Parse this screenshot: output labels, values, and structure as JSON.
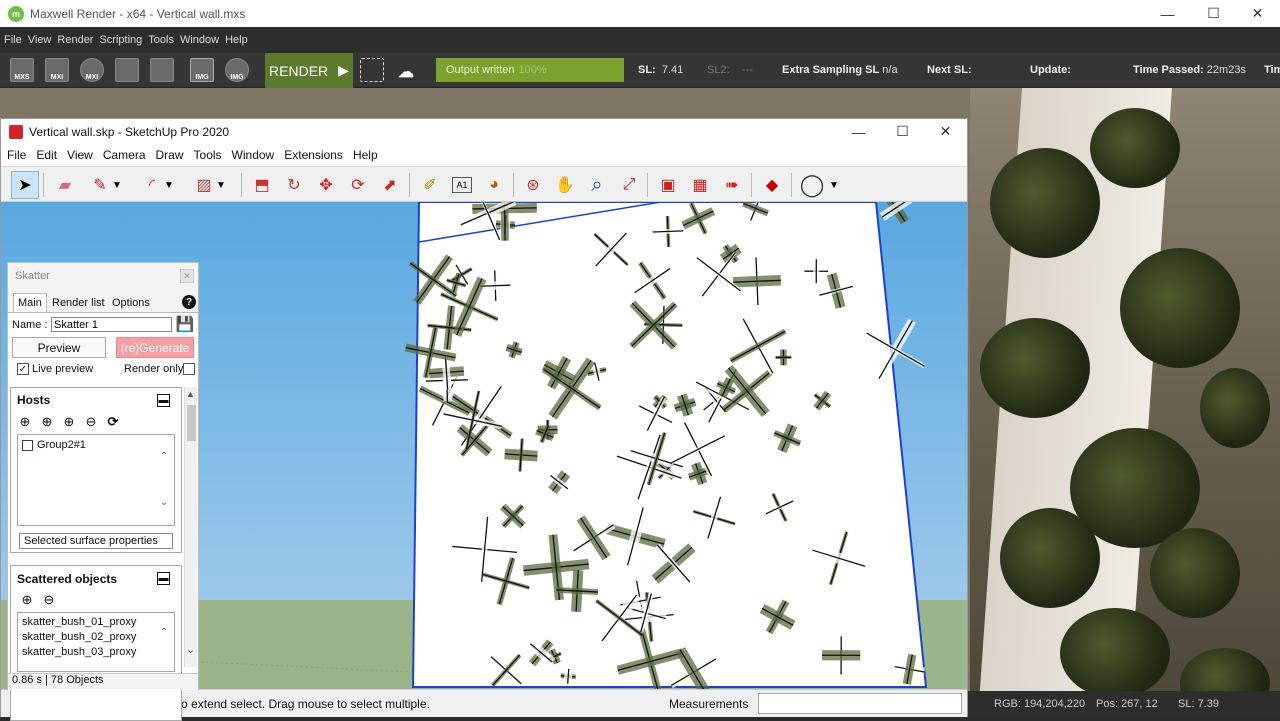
{
  "maxwell": {
    "title": "Maxwell Render  -  x64 - Vertical wall.mxs",
    "menu": [
      "File",
      "View",
      "Render",
      "Scripting",
      "Tools",
      "Window",
      "Help"
    ],
    "toolbar_icons": [
      {
        "name": "mxs-icon",
        "label": "MXS"
      },
      {
        "name": "mxi-icon",
        "label": "MXI"
      },
      {
        "name": "mxi-open-icon",
        "label": "MXI"
      },
      {
        "name": "compare-icon",
        "label": ""
      },
      {
        "name": "save-icon",
        "label": ""
      },
      {
        "name": "img-icon",
        "label": "IMG"
      },
      {
        "name": "img-save-icon",
        "label": "IMG"
      }
    ],
    "render_label": "RENDER",
    "progress_text": "Output written",
    "progress_pct": "100%",
    "progress_fraction": 1.0,
    "sl_label": "SL:",
    "sl_value": "7.41",
    "sl2_label": "SL2:",
    "sl2_value": "---",
    "extra_label": "Extra Sampling SL",
    "extra_value": "n/a",
    "next_sl_label": "Next SL:",
    "update_label": "Update:",
    "time_label": "Time Passed:",
    "time_value": "22m23s",
    "time_remaining_label": "Tim",
    "bottom": {
      "rgb": "RGB: 194,204,220",
      "pos": "Pos: 267, 12",
      "sl": "SL: 7.39"
    }
  },
  "sketchup": {
    "title": "Vertical wall.skp - SketchUp Pro 2020",
    "menu": [
      "File",
      "Edit",
      "View",
      "Camera",
      "Draw",
      "Tools",
      "Window",
      "Extensions",
      "Help"
    ],
    "tools": [
      {
        "name": "select-icon",
        "glyph": "➤"
      },
      {
        "name": "eraser-icon",
        "glyph": "▰"
      },
      {
        "name": "pencil-icon",
        "glyph": "✎"
      },
      {
        "name": "arc-icon",
        "glyph": "◜"
      },
      {
        "name": "rectangle-icon",
        "glyph": "▨"
      },
      {
        "name": "push-pull-icon",
        "glyph": "⬒"
      },
      {
        "name": "follow-me-icon",
        "glyph": "↻"
      },
      {
        "name": "move-icon",
        "glyph": "✥"
      },
      {
        "name": "rotate-icon",
        "glyph": "⟳"
      },
      {
        "name": "scale-icon",
        "glyph": "⬈"
      },
      {
        "name": "tape-measure-icon",
        "glyph": "✐"
      },
      {
        "name": "text-icon",
        "glyph": "A1"
      },
      {
        "name": "paint-bucket-icon",
        "glyph": "◕"
      },
      {
        "name": "orbit-icon",
        "glyph": "⊛"
      },
      {
        "name": "pan-icon",
        "glyph": "✋"
      },
      {
        "name": "zoom-icon",
        "glyph": "⌕"
      },
      {
        "name": "zoom-extents-icon",
        "glyph": "⤢"
      },
      {
        "name": "warehouse-icon",
        "glyph": "▣"
      },
      {
        "name": "extension-warehouse-icon",
        "glyph": "▦"
      },
      {
        "name": "send-to-layout-icon",
        "glyph": "➠"
      },
      {
        "name": "ruby-icon",
        "glyph": "◆"
      },
      {
        "name": "account-icon",
        "glyph": "◯"
      }
    ],
    "status_text": "Select objects. Shift to extend select. Drag mouse to select multiple.",
    "measurements_label": "Measurements"
  },
  "skatter": {
    "title": "Skatter",
    "tabs": [
      "Main",
      "Render list",
      "Options"
    ],
    "name_label": "Name :",
    "name_value": "Skatter 1",
    "preview_label": "Preview",
    "regenerate_label": "(re)Generate",
    "live_preview_label": "Live preview",
    "live_preview_checked": true,
    "render_only_label": "Render only",
    "render_only_checked": false,
    "hosts_title": "Hosts",
    "hosts": [
      "Group2#1"
    ],
    "selected_surface_label": "Selected surface properties",
    "scattered_title": "Scattered objects",
    "scattered": [
      "skatter_bush_01_proxy",
      "skatter_bush_02_proxy",
      "skatter_bush_03_proxy"
    ],
    "status": "0.86 s | 78 Objects"
  },
  "colors": {
    "render_green": "#5c7a2e",
    "progress_green": "#7ba12f",
    "regenerate_pink": "#f4a0a4",
    "sky_blue": "#58a8e0",
    "ground_green": "#9bb58a"
  }
}
